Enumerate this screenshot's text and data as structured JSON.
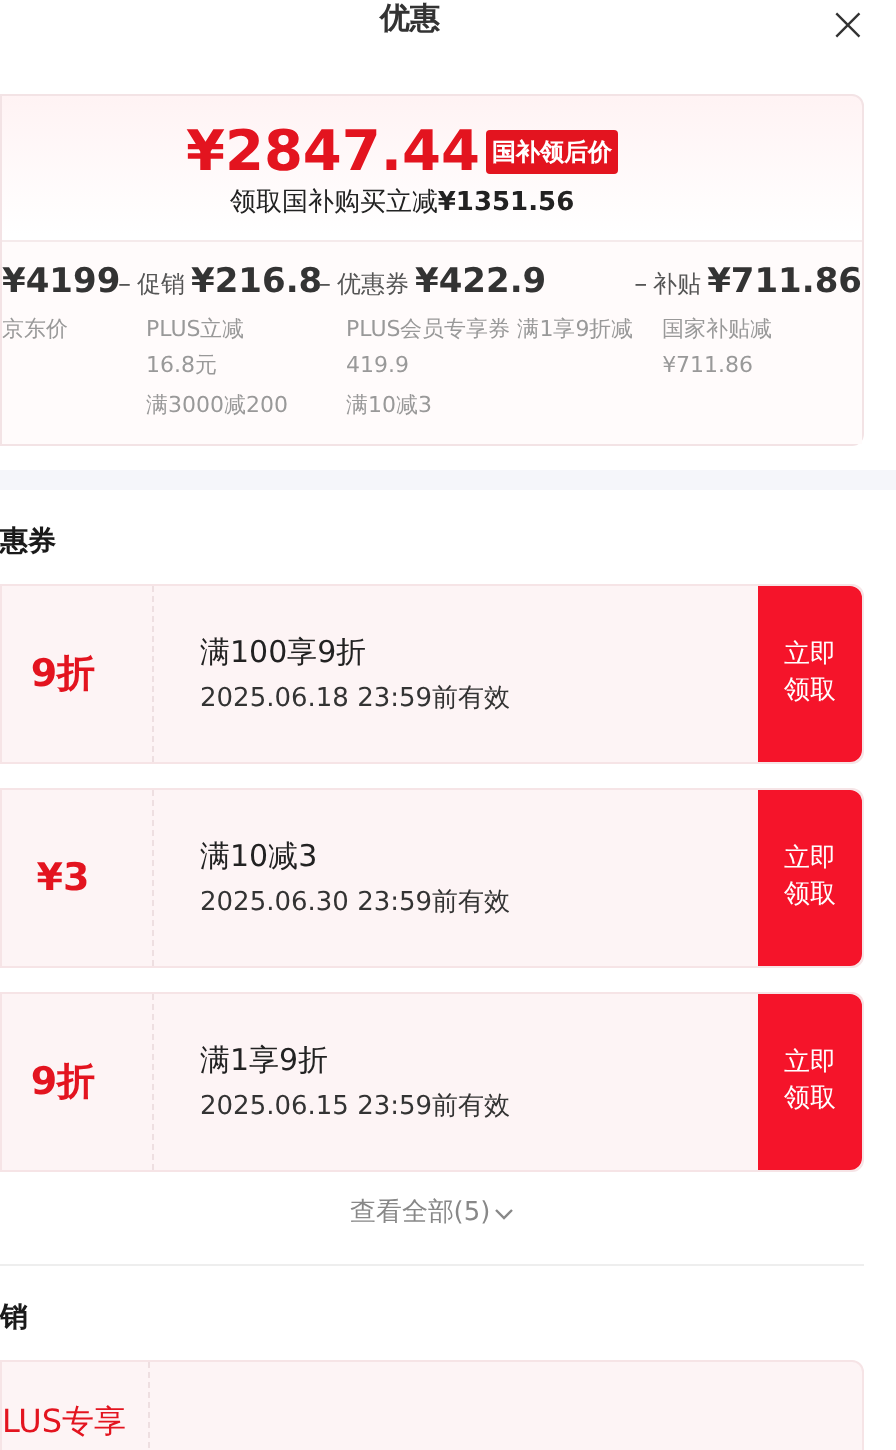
{
  "header": {
    "title": "优惠",
    "close": "×"
  },
  "price_card": {
    "price": "¥2847.44",
    "price_tag": "国补领后价",
    "subtitle": "领取国补购买立减**¥1351.56**",
    "breakdown": [
      {
        "amount": "¥4199",
        "notes": [
          "京东价"
        ]
      },
      {
        "operator": "–",
        "label": "促销",
        "amount": "¥216.8",
        "notes": [
          "PLUS立减\n16.8元",
          "满3000减200"
        ]
      },
      {
        "operator": "–",
        "label": "优惠券",
        "amount": "¥422.9",
        "notes": [
          "PLUS会员专享券 满1享9折减\n419.9",
          "满10减3"
        ]
      },
      {
        "operator": "–",
        "label": "补贴",
        "amount": "¥711.86",
        "notes": [
          "国家补贴减\n¥711.86"
        ]
      }
    ]
  },
  "coupon_section": {
    "title": "惠券",
    "coupons": [
      {
        "value": "9折",
        "condition": "满100享9折",
        "validity": "2025.06.18 23:59前有效",
        "action": "立即领取"
      },
      {
        "value": "¥3",
        "condition": "满10减3",
        "validity": "2025.06.30 23:59前有效",
        "action": "立即领取"
      },
      {
        "value": "9折",
        "condition": "满1享9折",
        "validity": "2025.06.15 23:59前有效",
        "action": "立即领取"
      }
    ],
    "view_all": "查看全部(5)"
  },
  "promo_section": {
    "title": "销",
    "items": [
      {
        "tag": "LUS专享"
      }
    ]
  }
}
